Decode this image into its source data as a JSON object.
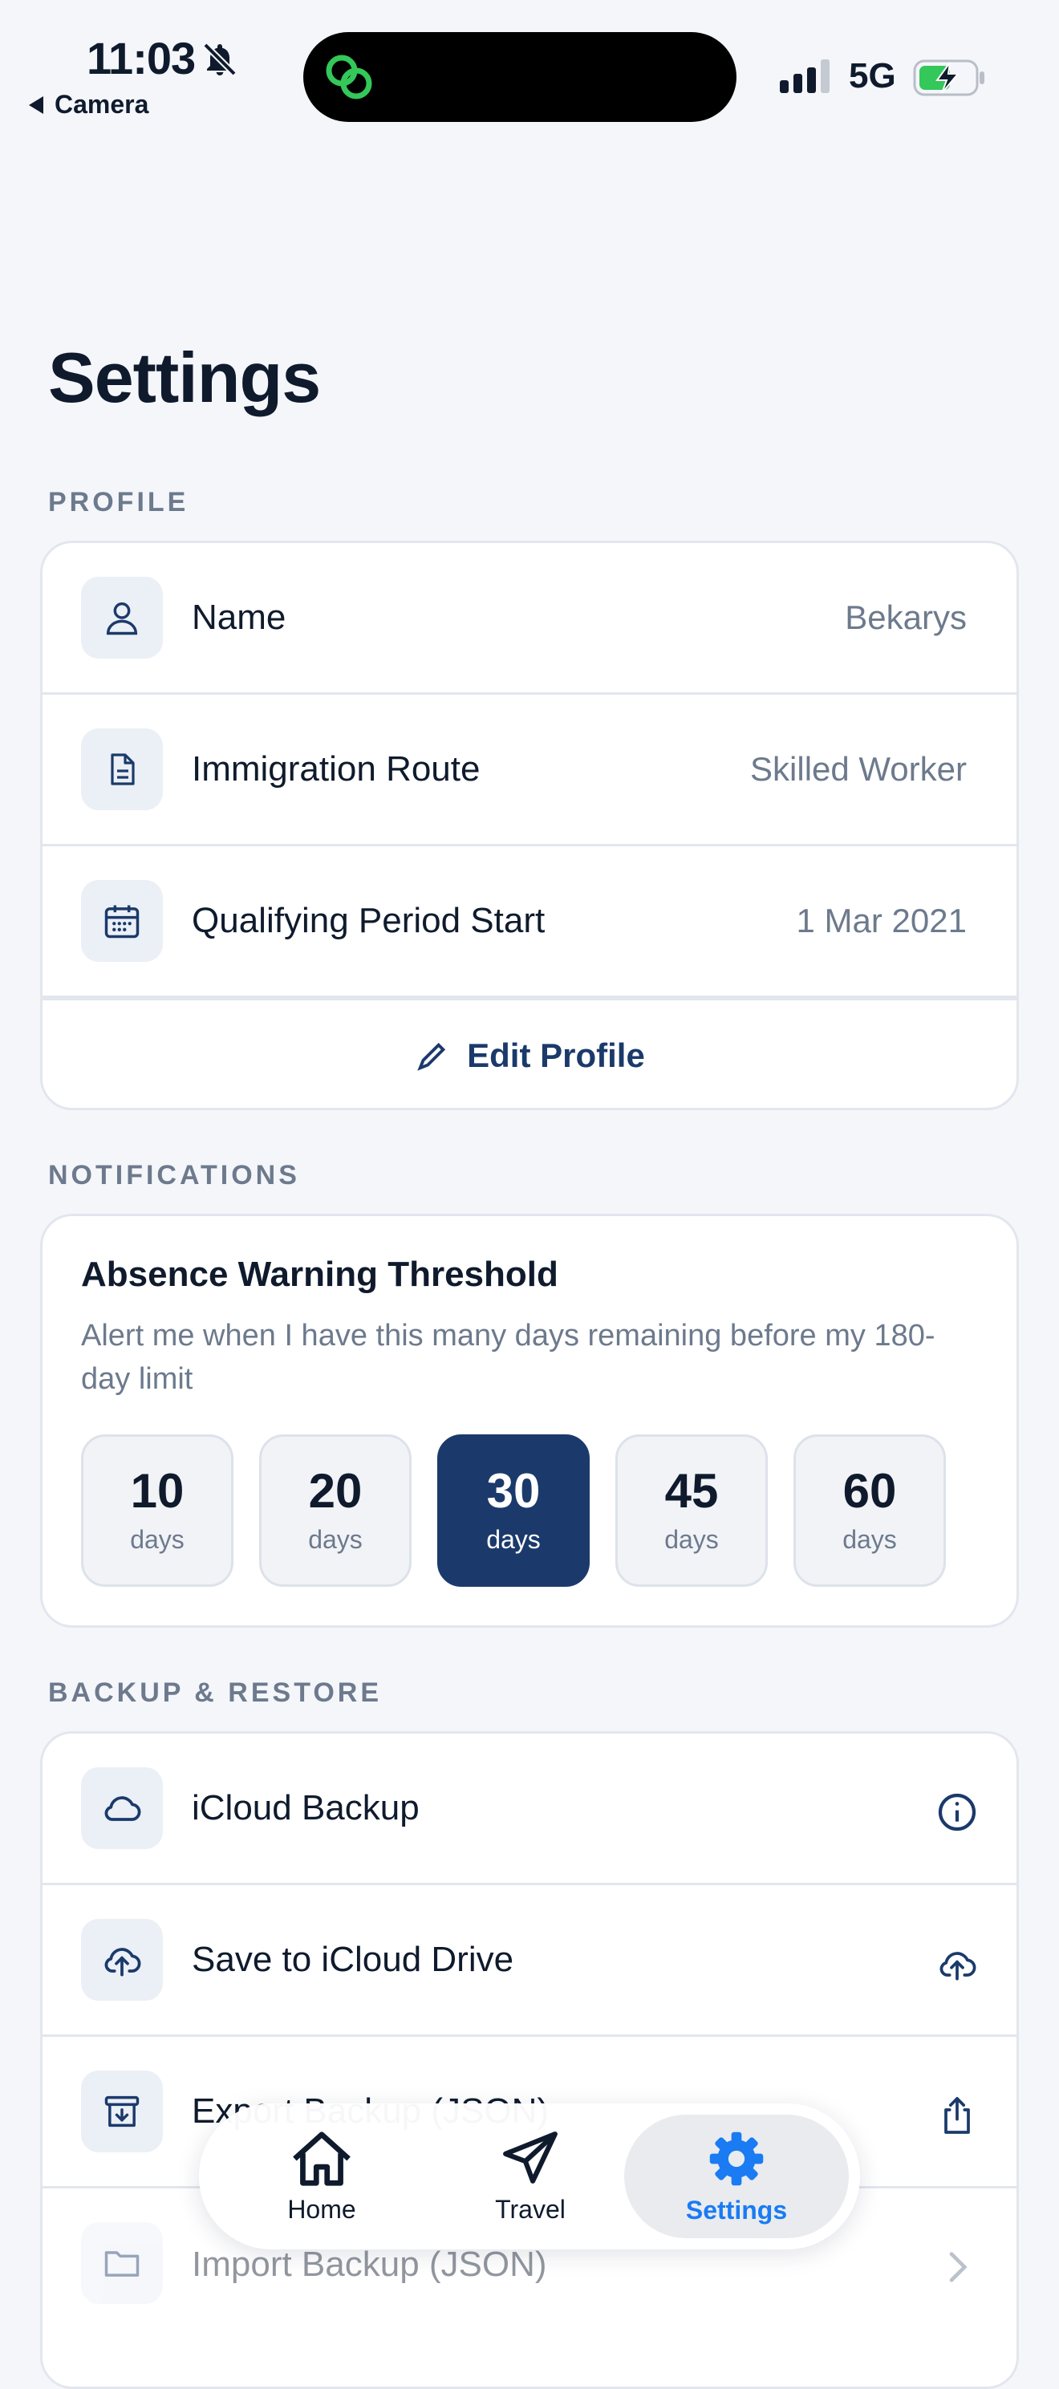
{
  "status_bar": {
    "time": "11:03",
    "back_app": "Camera",
    "network": "5G"
  },
  "page": {
    "title": "Settings"
  },
  "profile": {
    "section_label": "PROFILE",
    "rows": [
      {
        "label": "Name",
        "value": "Bekarys",
        "icon": "person-icon"
      },
      {
        "label": "Immigration Route",
        "value": "Skilled Worker",
        "icon": "document-icon"
      },
      {
        "label": "Qualifying Period Start",
        "value": "1 Mar 2021",
        "icon": "calendar-icon"
      }
    ],
    "edit_label": "Edit Profile"
  },
  "notifications": {
    "section_label": "NOTIFICATIONS",
    "title": "Absence Warning Threshold",
    "description": "Alert me when I have this many days remaining before my 180-day limit",
    "options": [
      {
        "value": "10",
        "unit": "days"
      },
      {
        "value": "20",
        "unit": "days"
      },
      {
        "value": "30",
        "unit": "days"
      },
      {
        "value": "45",
        "unit": "days"
      },
      {
        "value": "60",
        "unit": "days"
      }
    ],
    "selected": "30"
  },
  "backup": {
    "section_label": "BACKUP & RESTORE",
    "rows": [
      {
        "label": "iCloud Backup",
        "icon": "cloud-icon",
        "trail": "info-icon"
      },
      {
        "label": "Save to iCloud Drive",
        "icon": "cloud-upload-icon",
        "trail": "cloud-upload-icon"
      },
      {
        "label": "Export Backup (JSON)",
        "icon": "archive-icon",
        "trail": "share-icon"
      },
      {
        "label": "Import Backup (JSON)",
        "icon": "folder-icon",
        "trail": "chevron-right-icon"
      }
    ]
  },
  "tabbar": {
    "items": [
      {
        "label": "Home",
        "icon": "home-icon"
      },
      {
        "label": "Travel",
        "icon": "paper-plane-icon"
      },
      {
        "label": "Settings",
        "icon": "gear-icon"
      }
    ],
    "active": "Settings"
  },
  "colors": {
    "accent": "#1b3a6b",
    "tab_active": "#1a7bf2",
    "muted": "#6d7a8d",
    "background": "#f4f6fa"
  }
}
